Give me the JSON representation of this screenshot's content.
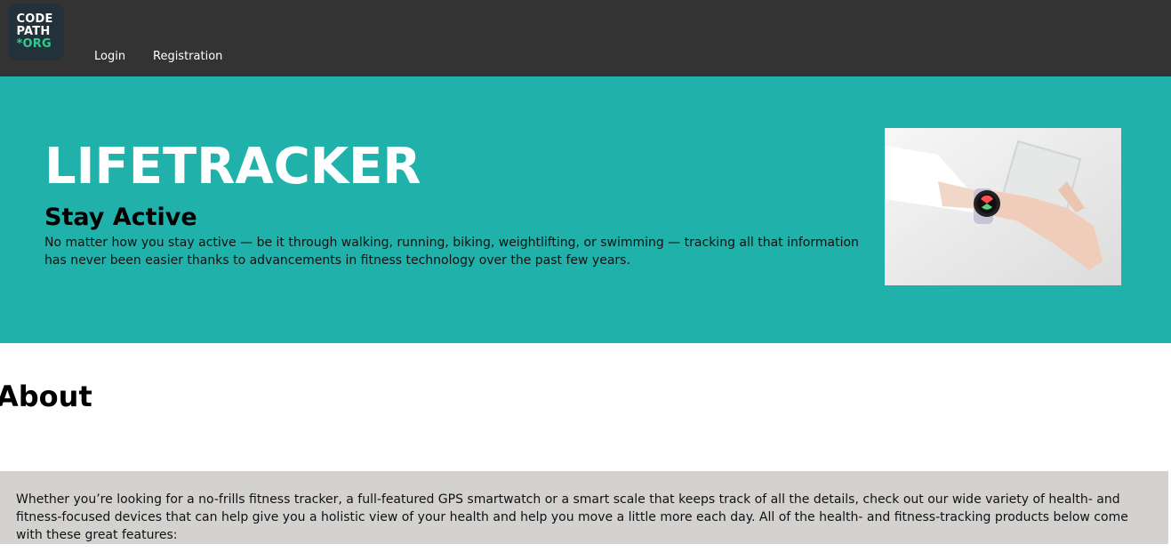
{
  "nav": {
    "logo": {
      "line1": "CODE",
      "line2": "PATH",
      "line3": "*ORG"
    },
    "links": {
      "login": "Login",
      "registration": "Registration"
    }
  },
  "hero": {
    "title": "LIFETRACKER",
    "subtitle": "Stay Active",
    "text": "No matter how you stay active — be it through walking, running, biking, weightlifting, or swimming — tracking all that information has never been easier thanks to advancements in fitness technology over the past few years.",
    "image_icon": "smartwatch-photo"
  },
  "about": {
    "heading": "About",
    "text": "Whether you’re looking for a no-frills fitness tracker, a full-featured GPS smartwatch or a smart scale that keeps track of all the details, check out our wide variety of health- and fitness-focused devices that can help give you a holistic view of your health and help you move a little more each day. All of the health- and fitness-tracking products below come with these great features:"
  },
  "colors": {
    "navbar": "#333333",
    "hero": "#20b2aa",
    "about_box": "#d3d2d0",
    "logo_accent": "#2ecc8f"
  }
}
